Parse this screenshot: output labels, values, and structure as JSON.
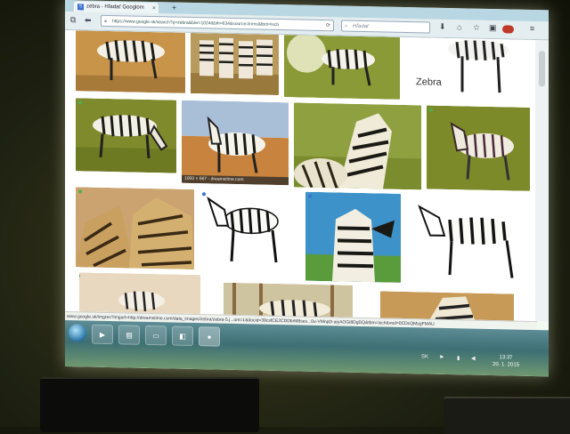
{
  "browser": {
    "tab_title": "zebra - Hľadať Googlom",
    "tab_favicon": "S",
    "tab_close": "×",
    "new_tab": "+",
    "url": "https://www.google.sk/search?q=zebra&biw=1024&bih=634&source=lnms&tbm=isch",
    "search_placeholder": "Hľadať",
    "icons": [
      "back-icon",
      "lock-icon",
      "reload-icon",
      "search-icon",
      "download-icon",
      "home-icon",
      "bookmark-star-icon",
      "clipboard-icon",
      "adblock-icon",
      "menu-icon"
    ]
  },
  "results": {
    "hover_caption": "1000 × 667 - dreamstime.com",
    "zebra_caption": "Zebra",
    "status_url": "www.google.sk/imgres?imgurl=http://dreamstime.com/data_images/zebra/zebra-5.j...om=1&docid=39csfCE2CDDbrM8ses...0u-VMnpD-aiyAOGi8DgDQ&tbm=isch&ved=0CDcQMygFMAU"
  },
  "taskbar": {
    "icons": [
      "start-orb-icon",
      "media-player-icon",
      "image-viewer-icon",
      "folder-icon",
      "gallery-icon",
      "firefox-icon"
    ],
    "language": "SK",
    "time": "13:37",
    "date": "20. 1. 2015"
  },
  "colors": {
    "tabbar": "#b9d7e2",
    "taskbar": "#3d6f74",
    "accent_green": "#4caf50"
  }
}
